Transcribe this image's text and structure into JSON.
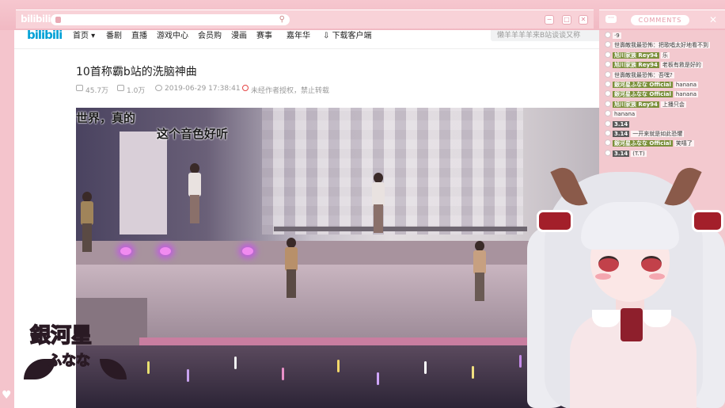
{
  "browser": {
    "logo": "bilibili",
    "search_icon": "search-icon"
  },
  "chat": {
    "header_label": "COMMENTS",
    "messages": [
      {
        "user": "",
        "text": "·9",
        "style": "dark"
      },
      {
        "user": "",
        "text": "世壽敵我最恐怖：把歌唱太好地看不到",
        "style": "none"
      },
      {
        "user": "旭川家族 Rey94",
        "text": "乐",
        "style": "green"
      },
      {
        "user": "旭川家族 Rey94",
        "text": "老板有救是好的",
        "style": "green"
      },
      {
        "user": "",
        "text": "世壽敵我最恐怖：吾嘿?",
        "style": "none"
      },
      {
        "user": "銀河星ふなな Official",
        "text": "hanana",
        "style": "green"
      },
      {
        "user": "銀河星ふなな Official",
        "text": "hanana",
        "style": "green"
      },
      {
        "user": "旭川家族 Rey94",
        "text": "上播只会",
        "style": "green"
      },
      {
        "user": "",
        "text": "hanana",
        "style": "none"
      },
      {
        "user": "3.14",
        "text": "",
        "style": "dark"
      },
      {
        "user": "3.14",
        "text": "一开来就是如此恐懼",
        "style": "dark"
      },
      {
        "user": "銀河星ふなな Official",
        "text": "笑嘻了",
        "style": "green"
      },
      {
        "user": "3.14",
        "text": "(T.T)",
        "style": "dark"
      }
    ]
  },
  "nav": {
    "items": [
      "首页 ▾",
      "番剧",
      "直播",
      "游戏中心",
      "会员购",
      "漫画",
      "赛事",
      "嘉年华",
      "下载客户端"
    ],
    "search_placeholder": "懒羊羊羊羊来B站谈谈又称"
  },
  "video": {
    "title": "10首称霸b站的洗脑神曲",
    "views": "45.7万",
    "danmaku": "1.0万",
    "date": "2019-06-29 17:38:41",
    "copyright": "未经作者授权，禁止转载",
    "subtitle_line1": "世界，真的",
    "subtitle_line2": "这个音色好听"
  },
  "brand": {
    "logo_text": "銀河星",
    "logo_sub": "ふなな"
  },
  "colors": {
    "frame": "#f3c9cf",
    "bili_blue": "#00a1d6",
    "chat_green": "#7a8f3a",
    "forbid_red": "#e54545"
  }
}
